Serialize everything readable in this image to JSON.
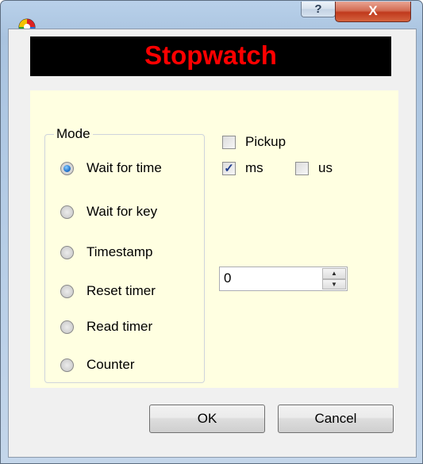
{
  "window": {
    "help_label": "?",
    "close_label": "X"
  },
  "banner": {
    "title": "Stopwatch",
    "color": "#ff0000"
  },
  "mode_group": {
    "legend": "Mode",
    "options": [
      {
        "label": "Wait for time",
        "checked": true
      },
      {
        "label": "Wait for key",
        "checked": false
      },
      {
        "label": "Timestamp",
        "checked": false
      },
      {
        "label": "Reset timer",
        "checked": false
      },
      {
        "label": "Read timer",
        "checked": false
      },
      {
        "label": "Counter",
        "checked": false
      }
    ]
  },
  "options": {
    "pickup": {
      "label": "Pickup",
      "checked": false
    },
    "ms": {
      "label": "ms",
      "checked": true
    },
    "us": {
      "label": "us",
      "checked": false
    }
  },
  "spin": {
    "value": "0"
  },
  "buttons": {
    "ok": "OK",
    "cancel": "Cancel"
  },
  "colors": {
    "panel_bg": "#ffffe1",
    "radio_selected": "#2a7bd1"
  },
  "icons": {
    "app": "app-icon",
    "help": "help-icon",
    "close": "close-icon"
  }
}
